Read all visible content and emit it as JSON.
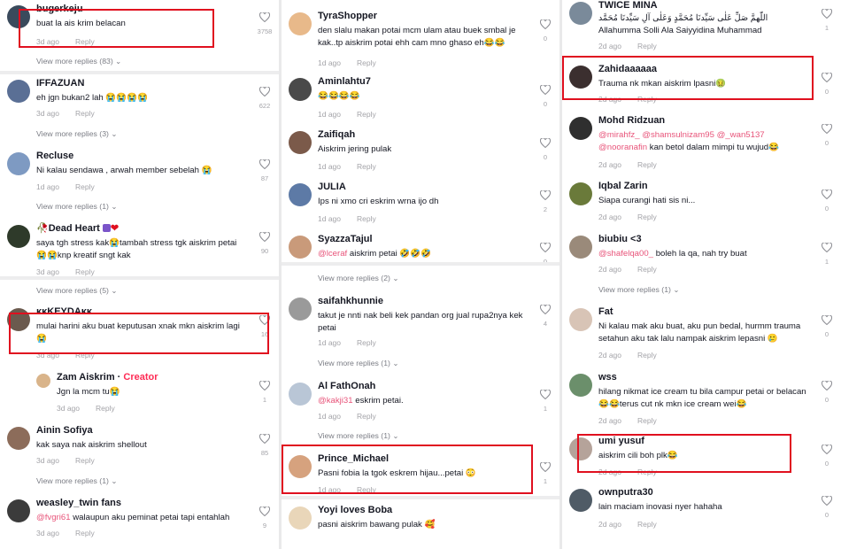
{
  "col1": {
    "c1": {
      "name": "bugerkeju",
      "text": "buat la ais krim belacan",
      "age": "3d ago",
      "reply": "Reply",
      "likes": "3758"
    },
    "vmr1": "View more replies (83)",
    "c2": {
      "name": "IFFAZUAN",
      "text": "eh jgn bukan2 lah 😭😭😭😭",
      "age": "3d ago",
      "reply": "Reply",
      "likes": "622"
    },
    "vmr2": "View more replies (3)",
    "c3": {
      "name": "Recluse",
      "text": "Ni kalau sendawa , arwah member sebelah 😭",
      "age": "1d ago",
      "reply": "Reply",
      "likes": "87"
    },
    "vmr3": "View more replies (1)",
    "c4": {
      "name": "Dead Heart",
      "text1": "saya tgh stress kak😭tambah stress tgk aiskrim petai",
      "text2": "😭😭knp kreatif sngt kak",
      "age": "3d ago",
      "reply": "Reply",
      "likes": "90"
    },
    "vmr4": "View more replies (5)",
    "c5": {
      "name": "ᴋᴋKEYDAᴋᴋ",
      "text": "mulai harini aku buat keputusan xnak mkn aiskrim lagi 😭",
      "age": "3d ago",
      "reply": "Reply",
      "likes": "16"
    },
    "c6": {
      "name": "Zam Aiskrim",
      "creator": "Creator",
      "text": "Jgn la mcm tu😭",
      "age": "3d ago",
      "reply": "Reply",
      "likes": "1"
    },
    "c7": {
      "name": "Ainin Sofiya",
      "text": "kak saya nak aiskrim shellout",
      "age": "3d ago",
      "reply": "Reply",
      "likes": "85"
    },
    "vmr5": "View more replies (1)",
    "c8": {
      "name": "weasley_twin fans",
      "mention": "@fvgri61",
      "text": "walaupun aku peminat petai tapi entahlah",
      "age": "3d ago",
      "reply": "Reply",
      "likes": "9"
    }
  },
  "col2": {
    "c1": {
      "name": "TyraShopper",
      "text": "den slalu makan potai mcm ulam atau buek smbal je kak..tp aiskrim potai ehh cam mno ghaso eh😂😂",
      "age": "1d ago",
      "reply": "Reply",
      "likes": "0"
    },
    "c2": {
      "name": "Aminlahtu7",
      "text": "😂😂😂😂",
      "age": "1d ago",
      "reply": "Reply",
      "likes": "0"
    },
    "c3": {
      "name": "Zaifiqah",
      "text": "Aiskrim jering pulak",
      "age": "1d ago",
      "reply": "Reply",
      "likes": "0"
    },
    "c4": {
      "name": "JULIA",
      "text": "Ips ni xmo cri eskrim wrna ijo dh",
      "age": "1d ago",
      "reply": "Reply",
      "likes": "2"
    },
    "c5": {
      "name": "SyazzaTajul",
      "mention": "@lceraf",
      "text": "aiskrim petai 🤣🤣🤣",
      "age": "1d ago",
      "reply": "Reply",
      "likes": "0"
    },
    "vmr1": "View more replies (2)",
    "c6": {
      "name": "saifahkhunnie",
      "text": "takut je nnti nak beli kek pandan org jual rupa2nya kek petai",
      "age": "1d ago",
      "reply": "Reply",
      "likes": "4"
    },
    "vmr2": "View more replies (1)",
    "c7": {
      "name": "Al FathOnah",
      "mention": "@kakji31",
      "text": "eskrim petai.",
      "age": "1d ago",
      "reply": "Reply",
      "likes": "1"
    },
    "vmr3": "View more replies (1)",
    "c8": {
      "name": "Prince_Michael",
      "text": "Pasni fobia la tgok eskrem hijau...petai 😳",
      "age": "1d ago",
      "reply": "Reply",
      "likes": "1"
    },
    "c9": {
      "name": "Yoyi loves Boba",
      "text": "pasni aiskrim bawang pulak 🥰"
    }
  },
  "col3": {
    "c1": {
      "name": "TWICE MINA",
      "text1": "اللّٰهمَّ صَلِّ عَلٰى سَيِّدنَا مُحَمَّدٍ وَعَلٰى آلِ سَيِّدنَا مُحَمَّد",
      "text2": "Allahumma Solli Ala Saiyyidina Muhammad",
      "age": "2d ago",
      "reply": "Reply",
      "likes": "1"
    },
    "c2": {
      "name": "Zahidaaaaaa",
      "text": "Trauma nk mkan aiskrim lpasni🤢",
      "age": "2d ago",
      "reply": "Reply",
      "likes": "0"
    },
    "c3": {
      "name": "Mohd Ridzuan",
      "m1": "@mirahfz_",
      "m2": "@shamsulnizam95",
      "m3": "@_wan5137",
      "m4": "@nooranafin",
      "text": "kan betol dalam mimpi tu wujud😂",
      "age": "2d ago",
      "reply": "Reply",
      "likes": "0"
    },
    "c4": {
      "name": "Iqbal Zarin",
      "text": "Siapa curangi hati sis ni...",
      "age": "2d ago",
      "reply": "Reply",
      "likes": "0"
    },
    "c5": {
      "name": "biubiu <3",
      "mention": "@shafelqa00_",
      "text": "boleh la qa, nah try buat",
      "age": "2d ago",
      "reply": "Reply",
      "likes": "1"
    },
    "vmr1": "View more replies (1)",
    "c6": {
      "name": "Fat",
      "text": "Ni kalau mak aku buat, aku pun bedal, hurmm trauma setahun aku tak lalu nampak aiskrim lepasni 🥲",
      "age": "2d ago",
      "reply": "Reply",
      "likes": "0"
    },
    "c7": {
      "name": "wss",
      "text": "hilang nikmat ice cream tu bila campur petai or belacan😂😂terus cut nk mkn ice cream wei😂",
      "age": "2d ago",
      "reply": "Reply",
      "likes": "0"
    },
    "c8": {
      "name": "umi yusuf",
      "text": "aiskrim cili boh plk😂",
      "age": "2d ago",
      "reply": "Reply",
      "likes": "0"
    },
    "c9": {
      "name": "ownputra30",
      "text": "lain maciam inovasi nyer hahaha",
      "age": "2d ago",
      "reply": "Reply",
      "likes": "0"
    }
  },
  "colors": {
    "highlight": "#e0101f",
    "mention": "#e8547a",
    "creator": "#fe2c55",
    "meta": "#a3a3a8"
  }
}
